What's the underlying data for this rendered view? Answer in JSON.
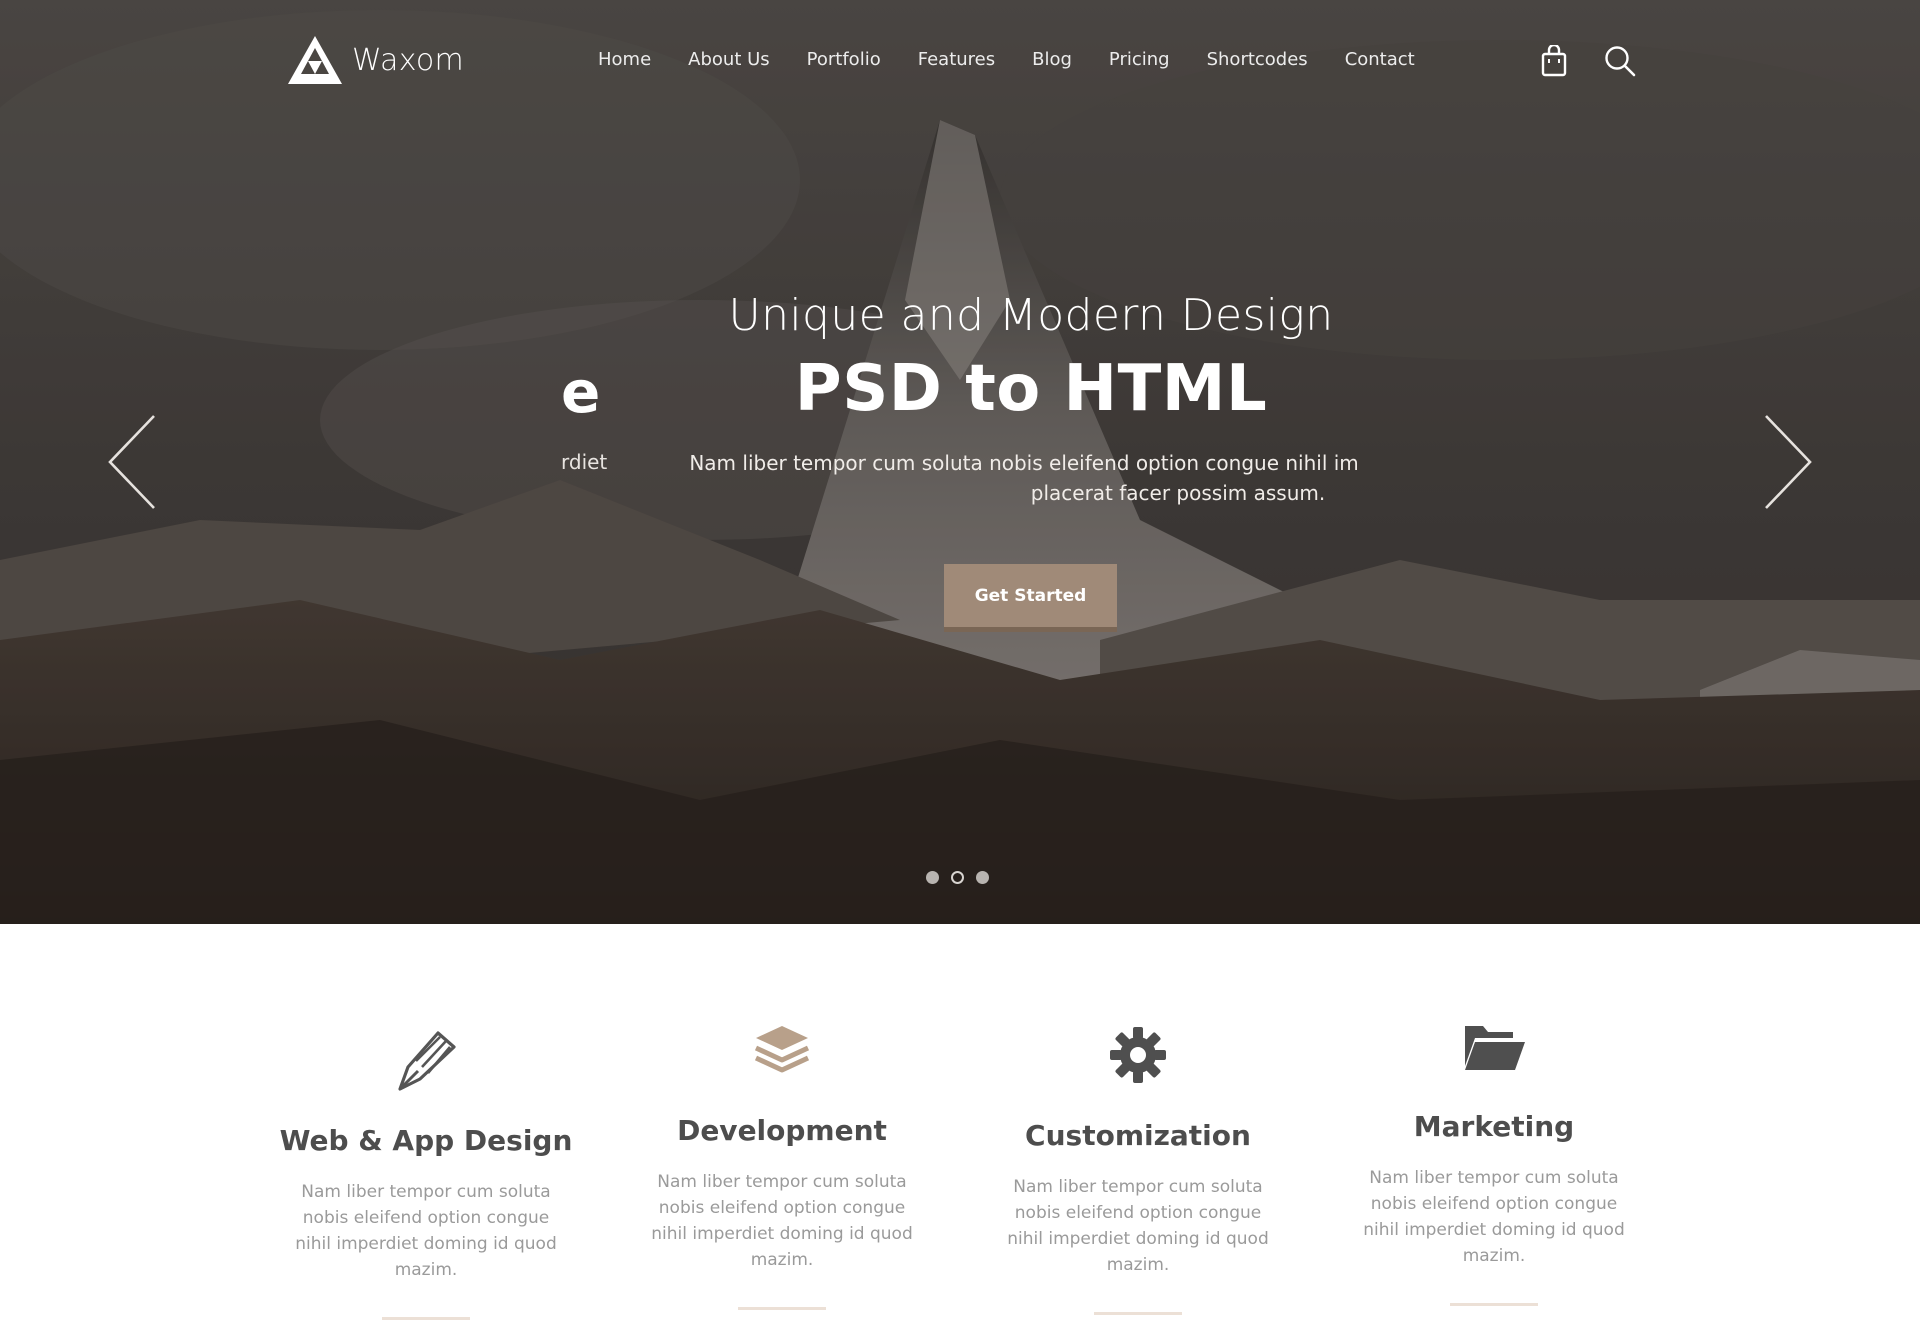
{
  "brand": {
    "name": "Waxom",
    "accent": "#a08a78",
    "accent_dark": "#7a6655"
  },
  "nav": {
    "links": [
      "Home",
      "About Us",
      "Portfolio",
      "Features",
      "Blog",
      "Pricing",
      "Shortcodes",
      "Contact"
    ],
    "icons": [
      "shopping-bag-icon",
      "search-icon"
    ]
  },
  "hero": {
    "subtitle": "Unique and Modern Design",
    "title": "PSD to HTML",
    "description": "Nam liber tempor cum soluta nobis eleifend option congue nihil imperdiet doming id quod mazim placerat facer possim assum.",
    "ghost_title": "e",
    "ghost_description": "rdiet",
    "button_label": "Get Started",
    "slide_count": 3,
    "active_slide": 2
  },
  "services": [
    {
      "icon": "pen-nib-icon",
      "title": "Web & App Design",
      "text": "Nam liber tempor cum soluta nobis eleifend option congue nihil imperdiet doming id quod mazim."
    },
    {
      "icon": "layers-icon",
      "title": "Development",
      "text": "Nam liber tempor cum soluta nobis eleifend option congue nihil imperdiet doming id quod mazim."
    },
    {
      "icon": "gear-icon",
      "title": "Customization",
      "text": "Nam liber tempor cum soluta nobis eleifend option congue nihil imperdiet doming id quod mazim."
    },
    {
      "icon": "folder-open-icon",
      "title": "Marketing",
      "text": "Nam liber tempor cum soluta nobis eleifend option congue nihil imperdiet doming id quod mazim."
    }
  ]
}
